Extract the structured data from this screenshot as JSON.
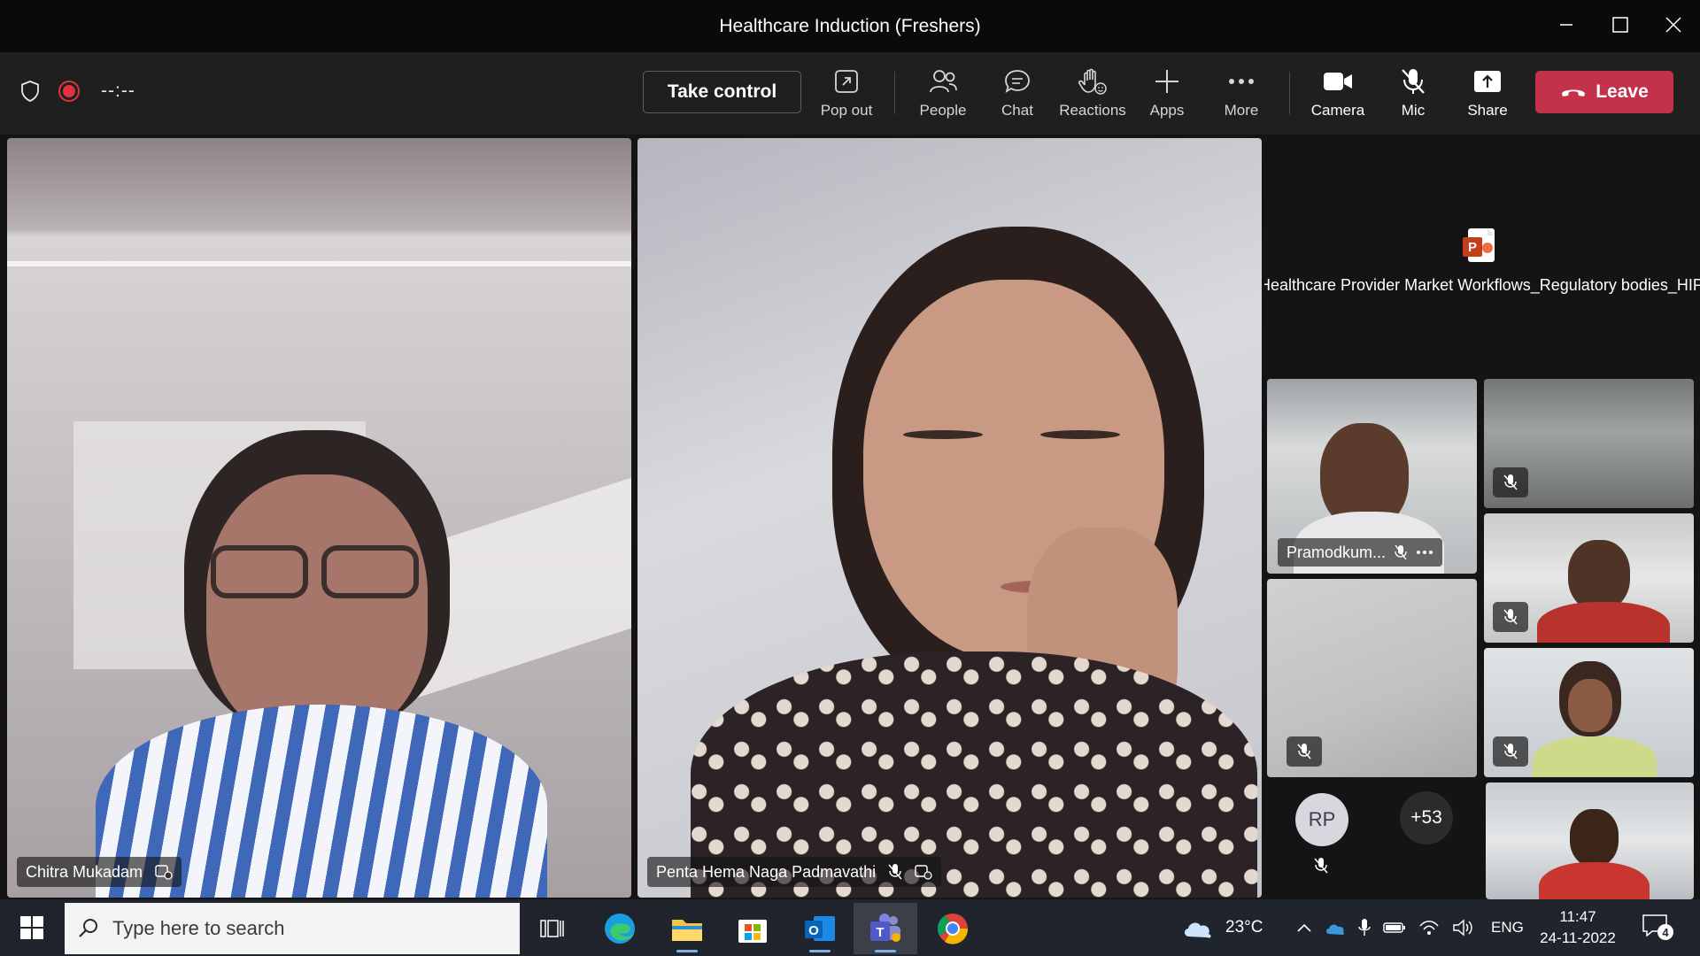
{
  "window": {
    "title": "Healthcare Induction (Freshers)"
  },
  "toolbar": {
    "timer": "--:--",
    "take_control": "Take control",
    "pop_out": "Pop out",
    "people": "People",
    "chat": "Chat",
    "reactions": "Reactions",
    "apps": "Apps",
    "more": "More",
    "camera": "Camera",
    "mic": "Mic",
    "share": "Share",
    "leave": "Leave"
  },
  "stage": {
    "main_left_name": "Chitra Mukadam",
    "main_center_name": "Penta Hema Naga Padmavathi",
    "shared_file_title": "Healthcare Provider Market Workflows_Regulatory bodies_HIPAA",
    "thumb_named": "Pramodkum...",
    "avatar_initials": "RP",
    "overflow_count": "+53"
  },
  "taskbar": {
    "search_placeholder": "Type here to search",
    "weather": "23°C",
    "language": "ENG",
    "time": "11:47",
    "date": "24-11-2022",
    "notifications": "4"
  },
  "colors": {
    "leave_red": "#c4314b",
    "record_red": "#e0343d",
    "taskbar_bg": "#20252d"
  }
}
